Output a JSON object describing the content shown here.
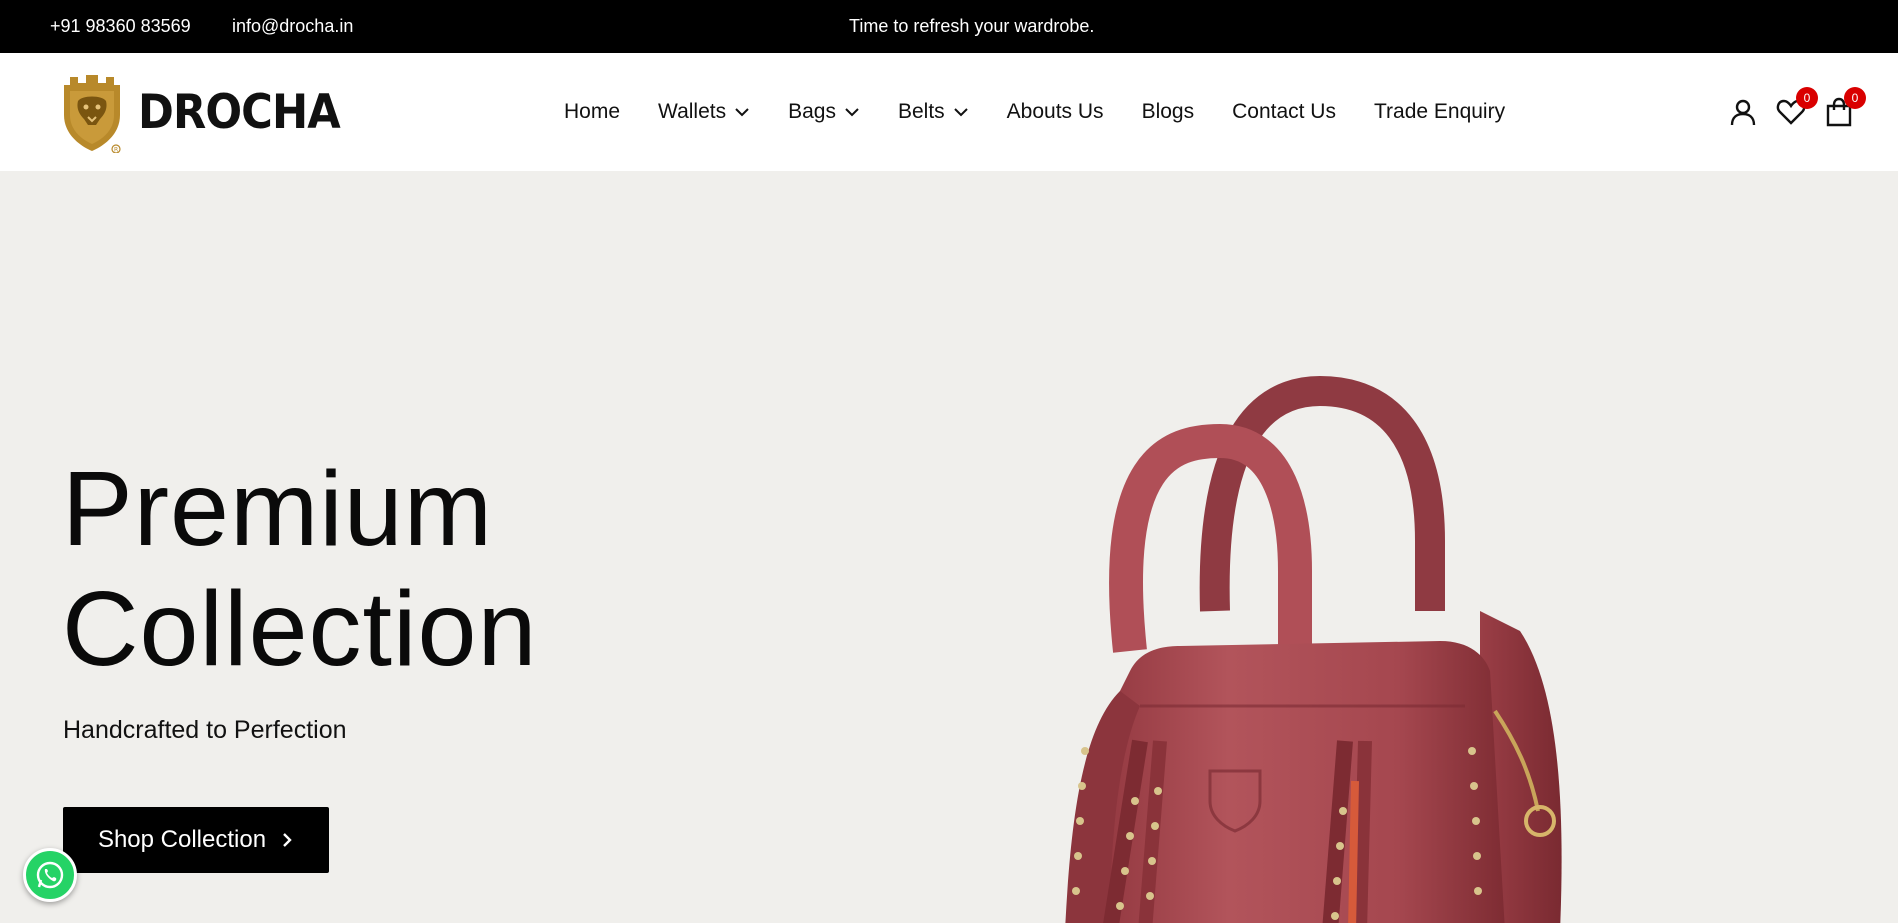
{
  "topbar": {
    "phone": "+91 98360 83569",
    "email": "info@drocha.in",
    "announcement": "Time to refresh your wardrobe."
  },
  "header": {
    "brand": "DROCHA",
    "nav": [
      {
        "label": "Home",
        "has_dropdown": false
      },
      {
        "label": "Wallets",
        "has_dropdown": true
      },
      {
        "label": "Bags",
        "has_dropdown": true
      },
      {
        "label": "Belts",
        "has_dropdown": true
      },
      {
        "label": "Abouts Us",
        "has_dropdown": false
      },
      {
        "label": "Blogs",
        "has_dropdown": false
      },
      {
        "label": "Contact Us",
        "has_dropdown": false
      },
      {
        "label": "Trade Enquiry",
        "has_dropdown": false
      }
    ],
    "icons": {
      "account": "user-icon",
      "wishlist": "heart-icon",
      "cart": "shopping-bag-icon"
    },
    "wishlist_count": "0",
    "cart_count": "0"
  },
  "hero": {
    "title_line1": "Premium",
    "title_line2": "Collection",
    "subtitle": "Handcrafted to Perfection",
    "cta_label": "Shop Collection"
  },
  "colors": {
    "topbar_bg": "#000000",
    "hero_bg": "#f0efec",
    "brand_gold": "#b8892a",
    "badge_red": "#d90000",
    "bag_red": "#a8464e",
    "whatsapp_green": "#25d366"
  }
}
